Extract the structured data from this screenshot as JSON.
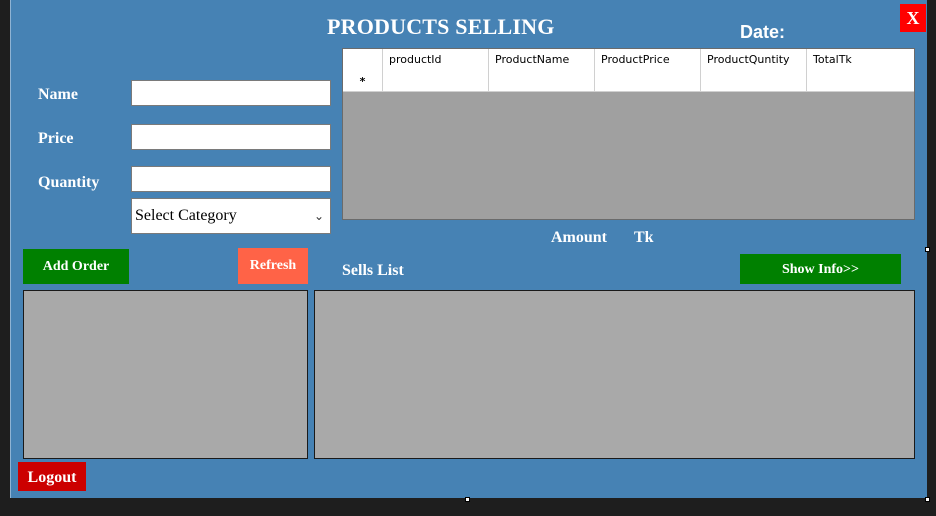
{
  "header": {
    "title": "PRODUCTS SELLING",
    "date_label": "Date:",
    "close_label": "X"
  },
  "form": {
    "name_label": "Name",
    "price_label": "Price",
    "quantity_label": "Quantity",
    "name_value": "",
    "price_value": "",
    "quantity_value": "",
    "category_selected": "Select Category"
  },
  "grid": {
    "columns": [
      "productId",
      "ProductName",
      "ProductPrice",
      "ProductQuntity",
      "TotalTk"
    ],
    "new_row_marker": "*"
  },
  "amount": {
    "label": "Amount",
    "unit": "Tk"
  },
  "buttons": {
    "add_order": "Add Order",
    "refresh": "Refresh",
    "show_info": "Show Info>>",
    "logout": "Logout"
  },
  "sells": {
    "label": "Sells List"
  },
  "colors": {
    "form_bg": "#4682b4",
    "green": "#008000",
    "tomato": "#ff6347",
    "close_red": "#ff0000",
    "logout_red": "#cc0000",
    "panel_gray": "#a9a9a9"
  }
}
